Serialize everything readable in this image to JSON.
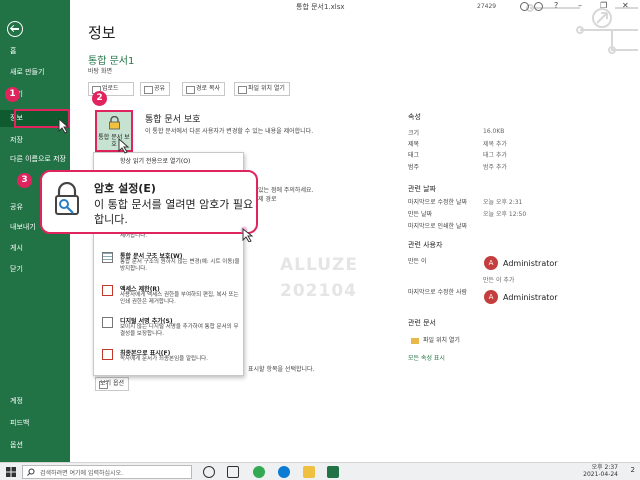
{
  "window": {
    "title": "통합 문서1.xlsx",
    "status_number": "27429"
  },
  "sidebar": {
    "items": [
      {
        "label": "홈"
      },
      {
        "label": "새로 만들기"
      },
      {
        "label": "열기"
      },
      {
        "label": "정보"
      },
      {
        "label": "저장"
      },
      {
        "label": "다른 이름으로 저장"
      },
      {
        "label": "인쇄"
      },
      {
        "label": "공유"
      },
      {
        "label": "내보내기"
      },
      {
        "label": "게시"
      },
      {
        "label": "닫기"
      },
      {
        "label": "계정"
      },
      {
        "label": "피드백"
      },
      {
        "label": "옵션"
      }
    ]
  },
  "main": {
    "page_title": "정보",
    "workbook_name": "통합 문서1",
    "workbook_location": "바탕 화면",
    "actions": [
      {
        "label": "업로드"
      },
      {
        "label": "공유"
      },
      {
        "label": "경로 복사"
      },
      {
        "label": "파일 위치 열기"
      }
    ],
    "protect": {
      "tile_label": "통합 문서 보호",
      "title": "통합 문서 보호",
      "description": "이 통합 문서에서 다른 사용자가 변경할 수 있는 내용을 제어합니다.",
      "menu": [
        {
          "title": "항상 읽기 전용으로 열기(O)",
          "description": ""
        },
        {
          "title": "통합 문서 구조 보호(W)",
          "description": "통합 문서 구조의 원하지 않는 변경(예: 시트 이동)을 방지합니다."
        },
        {
          "title": "액세스 제한(R)",
          "description": "사용자에게 액세스 권한을 부여하되 편집, 복사 또는 인쇄 권한은 제거합니다."
        },
        {
          "title": "디지털 서명 추가(S)",
          "description": "보이지 않는 디지털 서명을 추가하여 통합 문서의 무결성을 보장합니다."
        },
        {
          "title": "최종본으로 표시(F)",
          "description": "독자에게 문서가 최종본임을 알립니다."
        }
      ],
      "partial_description": "제어합니다."
    },
    "side_notes": [
      "있는 점에 주의하세요.",
      "제 경로"
    ],
    "bottom_note": "표시할 항목을 선택합니다.",
    "view_options_label": "보기 옵션"
  },
  "callout": {
    "title": "암호 설정(E)",
    "description": "이 통합 문서를 열려면 암호가 필요합니다."
  },
  "badges": [
    "1",
    "2",
    "3"
  ],
  "properties": {
    "heading": "속성",
    "rows": [
      {
        "label": "크기",
        "value": "16.0KB"
      },
      {
        "label": "제목",
        "value": "제목 추가"
      },
      {
        "label": "태그",
        "value": "태그 추가"
      },
      {
        "label": "범주",
        "value": "범주 추가"
      }
    ],
    "dates_heading": "관련 날짜",
    "dates": [
      {
        "label": "마지막으로 수정한 날짜",
        "value": "오늘 오후 2:31"
      },
      {
        "label": "만든 날짜",
        "value": "오늘 오후 12:50"
      },
      {
        "label": "마지막으로 인쇄한 날짜",
        "value": ""
      }
    ],
    "people_heading": "관련 사용자",
    "author_label": "만든 이",
    "author_name": "Administrator",
    "add_author": "만든 이 추가",
    "modified_by_label": "마지막으로 수정한 사람",
    "modified_by_name": "Administrator",
    "avatar_letter": "A",
    "docs_heading": "관련 문서",
    "open_folder": "파일 위치 열기",
    "show_all": "모든 속성 표시"
  },
  "watermark": [
    "ALLUZE",
    "202104"
  ],
  "taskbar": {
    "search_placeholder": "검색하려면 여기에 입력하십시오.",
    "time": "오후 2:37",
    "date": "2021-04-24",
    "notifications": "2"
  },
  "colors": {
    "excel_green": "#217346",
    "highlight_pink": "#e0245e"
  }
}
